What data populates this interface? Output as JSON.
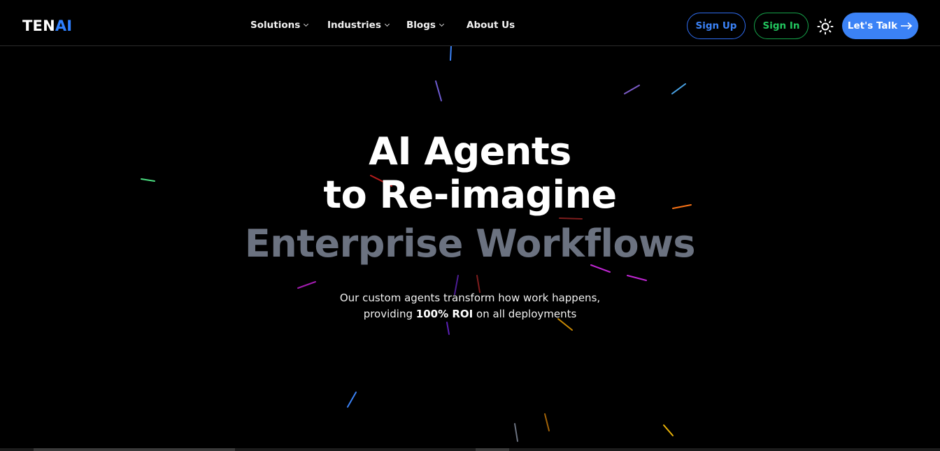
{
  "header": {
    "logo": {
      "part1": "TEN",
      "part2": "AI",
      "color_part2": "#2f80ff"
    },
    "nav": [
      {
        "label": "Solutions",
        "has_dropdown": true
      },
      {
        "label": "Industries",
        "has_dropdown": true
      },
      {
        "label": "Blogs",
        "has_dropdown": true
      },
      {
        "label": "About Us",
        "has_dropdown": false
      }
    ],
    "sign_up_label": "Sign Up",
    "sign_in_label": "Sign In",
    "theme_toggle_icon": "sun-icon",
    "cta_label": "Let's Talk",
    "cta_icon": "arrow-right-icon"
  },
  "hero": {
    "line1": "AI Agents",
    "line2": "to Re-imagine",
    "line3": "Enterprise Workflows",
    "subtitle_line1": "Our custom agents transform how work happens,",
    "subtitle_line2_prefix": "providing",
    "subtitle_line2_bold": "100% ROI",
    "subtitle_line2_suffix": "on all deployments"
  },
  "colors": {
    "background": "#000000",
    "accent_blue": "#3b82f6",
    "accent_green": "#22c55e",
    "muted_heading": "#6b7280"
  }
}
